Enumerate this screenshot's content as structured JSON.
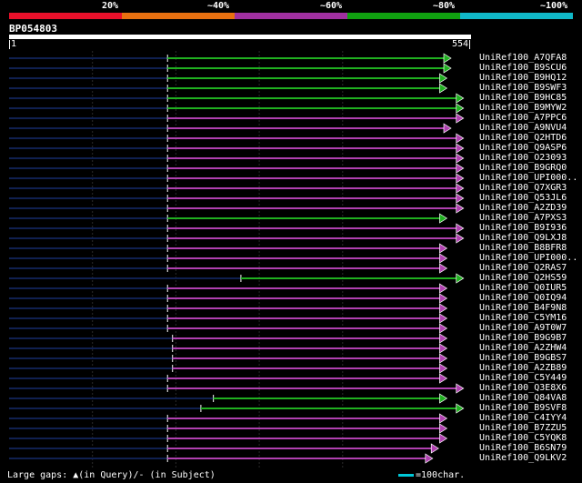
{
  "legend": {
    "segments": [
      {
        "label": "20%",
        "color": "#e8102a"
      },
      {
        "label": "~40%",
        "color": "#e87010"
      },
      {
        "label": "~60%",
        "color": "#a030a0"
      },
      {
        "label": "~80%",
        "color": "#10a010"
      },
      {
        "label": "~100%",
        "color": "#10b8c8"
      }
    ]
  },
  "query": {
    "name": "BP054803",
    "start": "1",
    "end": "554",
    "length": 554
  },
  "hits": [
    {
      "label": "UniRef100_A7QFA8",
      "color": "green",
      "start": 190,
      "end": 530,
      "arrow": "green"
    },
    {
      "label": "UniRef100_B9SCU6",
      "color": "green",
      "start": 190,
      "end": 530,
      "arrow": "green"
    },
    {
      "label": "UniRef100_B9HQ12",
      "color": "green",
      "start": 190,
      "end": 525,
      "arrow": "green"
    },
    {
      "label": "UniRef100_B9SWF3",
      "color": "green",
      "start": 190,
      "end": 525,
      "arrow": "green"
    },
    {
      "label": "UniRef100_B9HC85",
      "color": "green",
      "start": 190,
      "end": 545,
      "arrow": "green"
    },
    {
      "label": "UniRef100_B9MYW2",
      "color": "green",
      "start": 190,
      "end": 545,
      "arrow": "green"
    },
    {
      "label": "UniRef100_A7PPC6",
      "color": "magenta",
      "start": 190,
      "end": 545,
      "arrow": "magenta"
    },
    {
      "label": "UniRef100_A9NVU4",
      "color": "magenta",
      "start": 190,
      "end": 530,
      "arrow": "magenta"
    },
    {
      "label": "UniRef100_Q2HTD6",
      "color": "magenta",
      "start": 190,
      "end": 545,
      "arrow": "magenta"
    },
    {
      "label": "UniRef100_Q9ASP6",
      "color": "magenta",
      "start": 190,
      "end": 545,
      "arrow": "magenta"
    },
    {
      "label": "UniRef100_O23093",
      "color": "magenta",
      "start": 190,
      "end": 545,
      "arrow": "magenta"
    },
    {
      "label": "UniRef100_B9GRQ0",
      "color": "magenta",
      "start": 190,
      "end": 545,
      "arrow": "magenta"
    },
    {
      "label": "UniRef100_UPI000..",
      "color": "magenta",
      "start": 190,
      "end": 545,
      "arrow": "magenta"
    },
    {
      "label": "UniRef100_Q7XGR3",
      "color": "magenta",
      "start": 190,
      "end": 545,
      "arrow": "magenta"
    },
    {
      "label": "UniRef100_Q53JL6",
      "color": "magenta",
      "start": 190,
      "end": 545,
      "arrow": "magenta"
    },
    {
      "label": "UniRef100_A2ZD39",
      "color": "magenta",
      "start": 190,
      "end": 545,
      "arrow": "magenta"
    },
    {
      "label": "UniRef100_A7PXS3",
      "color": "green",
      "start": 190,
      "end": 525,
      "arrow": "green"
    },
    {
      "label": "UniRef100_B9I936",
      "color": "magenta",
      "start": 190,
      "end": 545,
      "arrow": "magenta"
    },
    {
      "label": "UniRef100_Q9LXJ8",
      "color": "magenta",
      "start": 190,
      "end": 545,
      "arrow": "magenta"
    },
    {
      "label": "UniRef100_B8BFR8",
      "color": "magenta",
      "start": 190,
      "end": 525,
      "arrow": "magenta"
    },
    {
      "label": "UniRef100_UPI000..",
      "color": "magenta",
      "start": 190,
      "end": 525,
      "arrow": "magenta"
    },
    {
      "label": "UniRef100_Q2RAS7",
      "color": "magenta",
      "start": 190,
      "end": 525,
      "arrow": "magenta"
    },
    {
      "label": "UniRef100_Q2HS59",
      "color": "green",
      "start": 278,
      "end": 545,
      "arrow": "green"
    },
    {
      "label": "UniRef100_Q0IUR5",
      "color": "magenta",
      "start": 190,
      "end": 525,
      "arrow": "magenta"
    },
    {
      "label": "UniRef100_Q0IQ94",
      "color": "magenta",
      "start": 190,
      "end": 525,
      "arrow": "magenta"
    },
    {
      "label": "UniRef100_B4F9N8",
      "color": "magenta",
      "start": 190,
      "end": 525,
      "arrow": "magenta"
    },
    {
      "label": "UniRef100_C5YM16",
      "color": "magenta",
      "start": 190,
      "end": 525,
      "arrow": "magenta"
    },
    {
      "label": "UniRef100_A9T0W7",
      "color": "magenta",
      "start": 190,
      "end": 525,
      "arrow": "magenta"
    },
    {
      "label": "UniRef100_B9G9B7",
      "color": "magenta",
      "start": 196,
      "end": 525,
      "arrow": "magenta"
    },
    {
      "label": "UniRef100_A2ZHW4",
      "color": "magenta",
      "start": 196,
      "end": 525,
      "arrow": "magenta"
    },
    {
      "label": "UniRef100_B9GBS7",
      "color": "magenta",
      "start": 196,
      "end": 525,
      "arrow": "magenta"
    },
    {
      "label": "UniRef100_A2ZB89",
      "color": "magenta",
      "start": 196,
      "end": 525,
      "arrow": "magenta"
    },
    {
      "label": "UniRef100_C5Y449",
      "color": "magenta",
      "start": 190,
      "end": 525,
      "arrow": "magenta"
    },
    {
      "label": "UniRef100_Q3E8X6",
      "color": "magenta",
      "start": 190,
      "end": 545,
      "arrow": "magenta"
    },
    {
      "label": "UniRef100_Q84VA8",
      "color": "green",
      "start": 245,
      "end": 525,
      "arrow": "green"
    },
    {
      "label": "UniRef100_B9SVF8",
      "color": "green",
      "start": 230,
      "end": 545,
      "arrow": "green"
    },
    {
      "label": "UniRef100_C4IYY4",
      "color": "magenta",
      "start": 190,
      "end": 525,
      "arrow": "magenta"
    },
    {
      "label": "UniRef100_B7ZZU5",
      "color": "magenta",
      "start": 190,
      "end": 525,
      "arrow": "magenta"
    },
    {
      "label": "UniRef100_C5YQK8",
      "color": "magenta",
      "start": 190,
      "end": 525,
      "arrow": "magenta"
    },
    {
      "label": "UniRef100_B6SN79",
      "color": "magenta",
      "start": 190,
      "end": 515,
      "arrow": "magenta"
    },
    {
      "label": "UniRef100_Q9LKV2",
      "color": "magenta",
      "start": 190,
      "end": 508,
      "arrow": "magenta"
    }
  ],
  "footer": {
    "gaps_text": "Large gaps: ▲(in Query)/- (in Subject)",
    "scale_text": "=100char."
  },
  "colors": {
    "green": "#20b020",
    "magenta": "#b040b0",
    "navy": "#102050",
    "guide": "#2a2a2a"
  }
}
